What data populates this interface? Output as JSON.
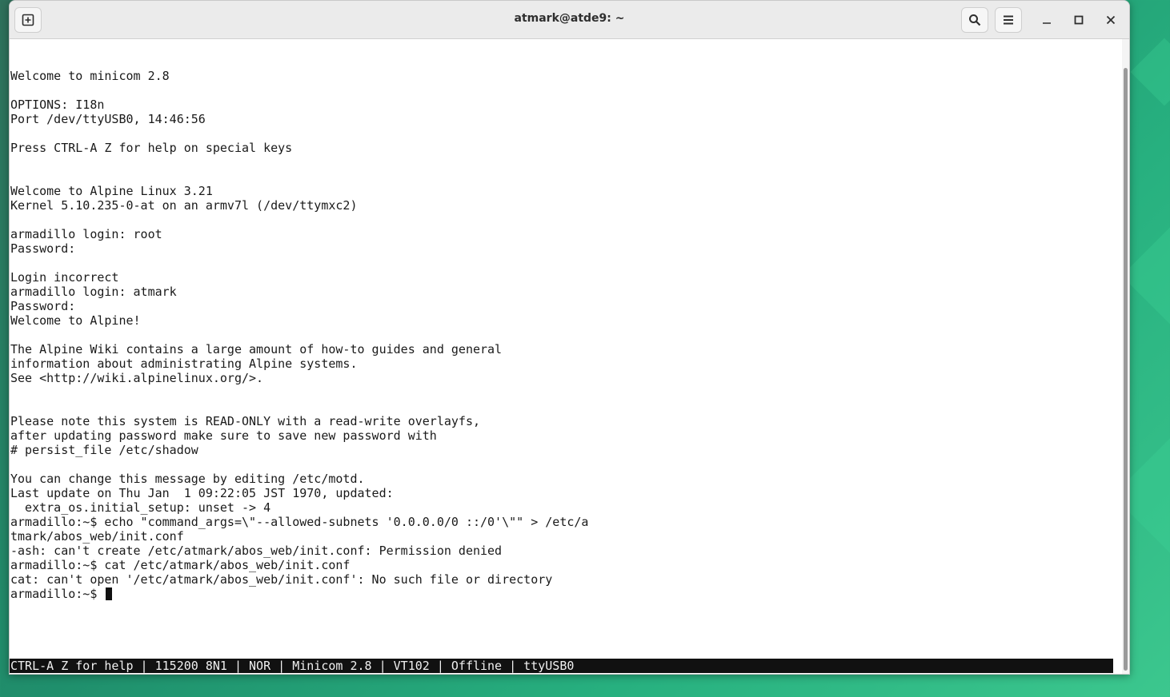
{
  "window": {
    "title": "atmark@atde9: ~"
  },
  "titlebar": {
    "new_tab_icon": "new-tab-icon",
    "search_icon": "search-icon",
    "menu_icon": "hamburger-menu-icon",
    "minimize_icon": "minimize-icon",
    "maximize_icon": "maximize-icon",
    "close_icon": "close-icon"
  },
  "terminal": {
    "lines": [
      "",
      "Welcome to minicom 2.8",
      "",
      "OPTIONS: I18n",
      "Port /dev/ttyUSB0, 14:46:56",
      "",
      "Press CTRL-A Z for help on special keys",
      "",
      "",
      "Welcome to Alpine Linux 3.21",
      "Kernel 5.10.235-0-at on an armv7l (/dev/ttymxc2)",
      "",
      "armadillo login: root",
      "Password:",
      "",
      "Login incorrect",
      "armadillo login: atmark",
      "Password:",
      "Welcome to Alpine!",
      "",
      "The Alpine Wiki contains a large amount of how-to guides and general",
      "information about administrating Alpine systems.",
      "See <http://wiki.alpinelinux.org/>.",
      "",
      "",
      "Please note this system is READ-ONLY with a read-write overlayfs,",
      "after updating password make sure to save new password with",
      "# persist_file /etc/shadow",
      "",
      "You can change this message by editing /etc/motd.",
      "Last update on Thu Jan  1 09:22:05 JST 1970, updated:",
      "  extra_os.initial_setup: unset -> 4",
      "armadillo:~$ echo \"command_args=\\\"--allowed-subnets '0.0.0.0/0 ::/0'\\\"\" > /etc/a",
      "tmark/abos_web/init.conf",
      "-ash: can't create /etc/atmark/abos_web/init.conf: Permission denied",
      "armadillo:~$ cat /etc/atmark/abos_web/init.conf",
      "cat: can't open '/etc/atmark/abos_web/init.conf': No such file or directory"
    ],
    "prompt": "armadillo:~$ "
  },
  "statusbar": {
    "text": "CTRL-A Z for help | 115200 8N1 | NOR | Minicom 2.8 | VT102 | Offline | ttyUSB0"
  }
}
